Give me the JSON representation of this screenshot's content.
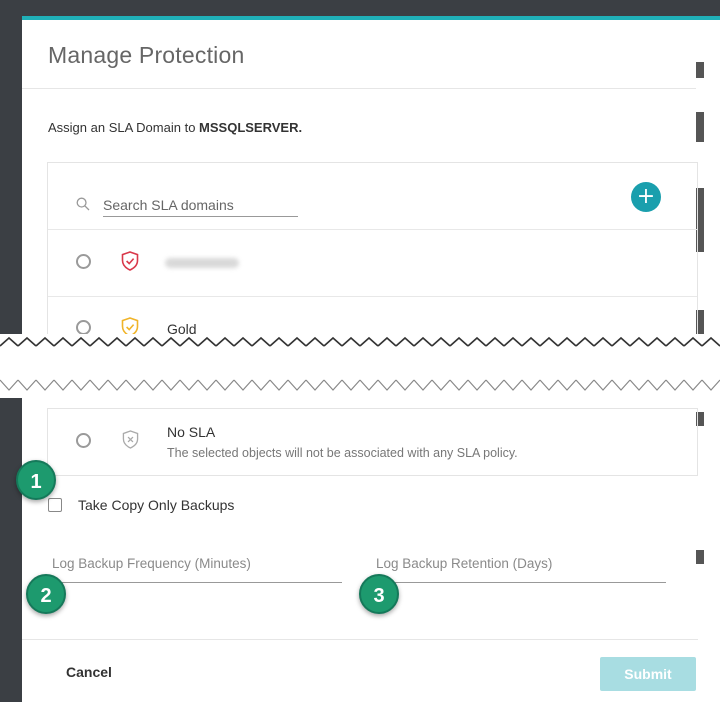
{
  "modal": {
    "title": "Manage Protection",
    "assign_prefix": "Assign an SLA Domain to ",
    "assign_target": "MSSQLSERVER."
  },
  "search": {
    "placeholder": "Search SLA domains",
    "value": ""
  },
  "sla_list": [
    {
      "name": "",
      "shield_color": "#d9384a",
      "blurred": true
    },
    {
      "name": "Gold",
      "shield_color": "#f0b429",
      "blurred": false
    }
  ],
  "no_sla": {
    "title": "No SLA",
    "description": "The selected objects will not be associated with any SLA policy."
  },
  "copy_only": {
    "label": "Take Copy Only Backups",
    "checked": false
  },
  "fields": {
    "log_frequency_placeholder": "Log Backup Frequency (Minutes)",
    "log_retention_placeholder": "Log Backup Retention (Days)"
  },
  "footer": {
    "cancel_label": "Cancel",
    "submit_label": "Submit"
  },
  "callouts": {
    "one": "1",
    "two": "2",
    "three": "3"
  },
  "colors": {
    "accent": "#20b0b8",
    "add_button": "#1a9fad",
    "callout": "#1d9a6e",
    "submit_disabled": "#a8dde2"
  },
  "icons": [
    "search-icon",
    "plus-icon",
    "shield-check-icon",
    "shield-x-icon"
  ]
}
